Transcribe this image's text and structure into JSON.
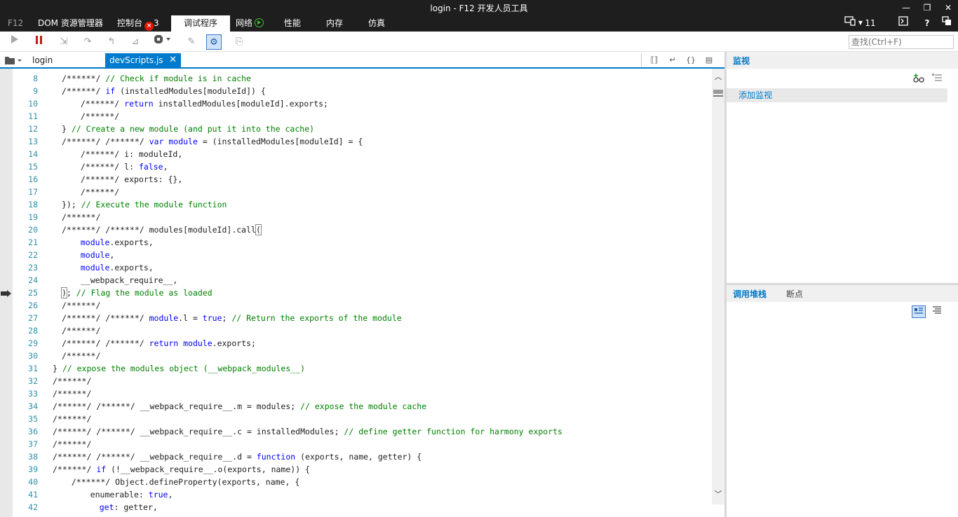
{
  "window": {
    "title": "login - F12 开发人员工具",
    "minimize": "—",
    "restore": "❐",
    "close": "✕"
  },
  "tabs": {
    "f12": "F12",
    "dom": "DOM 资源管理器",
    "console": "控制台",
    "console_errors": "3",
    "debugger": "调试程序",
    "network": "网络",
    "performance": "性能",
    "memory": "内存",
    "emulation": "仿真",
    "browser_target": "11",
    "help": "?"
  },
  "toolbar": {
    "continue_icon": "play-icon",
    "pause_icon": "pause-icon",
    "search_placeholder": "查找(Ctrl+F)"
  },
  "editor": {
    "tabs": [
      {
        "label": "login"
      },
      {
        "label": "devScripts.js",
        "close": "✕"
      }
    ],
    "lines": [
      {
        "num": "8",
        "code": [
          [
            "/******/ ",
            ""
          ],
          [
            "// Check if module is in cache",
            "cm"
          ]
        ]
      },
      {
        "num": "9",
        "code": [
          [
            "/******/ ",
            ""
          ],
          [
            "if",
            "kw"
          ],
          [
            " (installedModules[moduleId]) {",
            ""
          ]
        ]
      },
      {
        "num": "10",
        "code": [
          [
            "  /******/ ",
            ""
          ],
          [
            "return",
            "kw"
          ],
          [
            " installedModules[moduleId].exports;",
            ""
          ]
        ]
      },
      {
        "num": "11",
        "code": [
          [
            "  /******/",
            ""
          ]
        ]
      },
      {
        "num": "12",
        "code": [
          [
            "} ",
            ""
          ],
          [
            "// Create a new module (and put it into the cache)",
            "cm"
          ]
        ]
      },
      {
        "num": "13",
        "code": [
          [
            "/******/ /******/ ",
            ""
          ],
          [
            "var",
            "kw"
          ],
          [
            " ",
            ""
          ],
          [
            "module",
            "kw"
          ],
          [
            " = (installedModules[moduleId] = {",
            ""
          ]
        ]
      },
      {
        "num": "14",
        "code": [
          [
            "  /******/ i: moduleId,",
            ""
          ]
        ]
      },
      {
        "num": "15",
        "code": [
          [
            "  /******/ l: ",
            ""
          ],
          [
            "false",
            "kw"
          ],
          [
            ",",
            ""
          ]
        ]
      },
      {
        "num": "16",
        "code": [
          [
            "  /******/ exports: {},",
            ""
          ]
        ]
      },
      {
        "num": "17",
        "code": [
          [
            "  /******/",
            ""
          ]
        ]
      },
      {
        "num": "18",
        "code": [
          [
            "}); ",
            ""
          ],
          [
            "// Execute the module function",
            "cm"
          ]
        ]
      },
      {
        "num": "19",
        "code": [
          [
            "/******/",
            ""
          ]
        ]
      },
      {
        "num": "20",
        "code": [
          [
            "/******/ /******/ modules[moduleId].call",
            ""
          ],
          [
            "(",
            "brk"
          ]
        ]
      },
      {
        "num": "21",
        "code": [
          [
            "  ",
            ""
          ],
          [
            "module",
            "kw"
          ],
          [
            ".exports,",
            ""
          ]
        ]
      },
      {
        "num": "22",
        "code": [
          [
            "  ",
            ""
          ],
          [
            "module",
            "kw"
          ],
          [
            ",",
            ""
          ]
        ]
      },
      {
        "num": "23",
        "code": [
          [
            "  ",
            ""
          ],
          [
            "module",
            "kw"
          ],
          [
            ".exports,",
            ""
          ]
        ]
      },
      {
        "num": "24",
        "code": [
          [
            "  __webpack_require__,",
            ""
          ]
        ]
      },
      {
        "num": "25",
        "code": [
          [
            ")",
            "brk"
          ],
          [
            "; ",
            ""
          ],
          [
            "// Flag the module as loaded",
            "cm"
          ]
        ]
      },
      {
        "num": "26",
        "code": [
          [
            "/******/",
            ""
          ]
        ]
      },
      {
        "num": "27",
        "code": [
          [
            "/******/ /******/ ",
            ""
          ],
          [
            "module",
            "kw"
          ],
          [
            ".l = ",
            ""
          ],
          [
            "true",
            "kw"
          ],
          [
            "; ",
            ""
          ],
          [
            "// Return the exports of the module",
            "cm"
          ]
        ]
      },
      {
        "num": "28",
        "code": [
          [
            "/******/",
            ""
          ]
        ]
      },
      {
        "num": "29",
        "code": [
          [
            "/******/ /******/ ",
            ""
          ],
          [
            "return",
            "kw"
          ],
          [
            " ",
            ""
          ],
          [
            "module",
            "kw"
          ],
          [
            ".exports;",
            ""
          ]
        ]
      },
      {
        "num": "30",
        "code": [
          [
            "/******/",
            ""
          ]
        ]
      },
      {
        "num": "31",
        "code": [
          [
            "} ",
            ""
          ],
          [
            "// expose the modules object (__webpack_modules__)",
            "cm"
          ]
        ]
      },
      {
        "num": "32",
        "code": [
          [
            "/******/",
            ""
          ]
        ]
      },
      {
        "num": "33",
        "code": [
          [
            "/******/",
            ""
          ]
        ]
      },
      {
        "num": "34",
        "code": [
          [
            "/******/ /******/ __webpack_require__.m = modules; ",
            ""
          ],
          [
            "// expose the module cache",
            "cm"
          ]
        ]
      },
      {
        "num": "35",
        "code": [
          [
            "/******/",
            ""
          ]
        ]
      },
      {
        "num": "36",
        "code": [
          [
            "/******/ /******/ __webpack_require__.c = installedModules; ",
            ""
          ],
          [
            "// define getter function for harmony exports",
            "cm"
          ]
        ]
      },
      {
        "num": "37",
        "code": [
          [
            "/******/",
            ""
          ]
        ]
      },
      {
        "num": "38",
        "code": [
          [
            "/******/ /******/ __webpack_require__.d = ",
            ""
          ],
          [
            "function",
            "kw"
          ],
          [
            " (exports, name, getter) {",
            ""
          ]
        ]
      },
      {
        "num": "39",
        "code": [
          [
            "/******/ ",
            ""
          ],
          [
            "if",
            "kw"
          ],
          [
            " (!__webpack_require__.o(exports, name)) {",
            ""
          ]
        ]
      },
      {
        "num": "40",
        "code": [
          [
            "  /******/ Object.defineProperty(exports, name, {",
            ""
          ]
        ]
      },
      {
        "num": "41",
        "code": [
          [
            "    enumerable: ",
            ""
          ],
          [
            "true",
            "kw"
          ],
          [
            ",",
            ""
          ]
        ]
      },
      {
        "num": "42",
        "code": [
          [
            "    ",
            ""
          ],
          [
            "get",
            "kw"
          ],
          [
            ": getter,",
            ""
          ]
        ]
      }
    ]
  },
  "watch": {
    "title": "监视",
    "add_watch": "添加监视"
  },
  "callstack": {
    "tab_callstack": "调用堆栈",
    "tab_breakpoints": "断点"
  },
  "colors": {
    "accent": "#007acc",
    "keyword": "#0000ff",
    "comment": "#008000",
    "line_number": "#2b91af",
    "error": "#e51400"
  }
}
